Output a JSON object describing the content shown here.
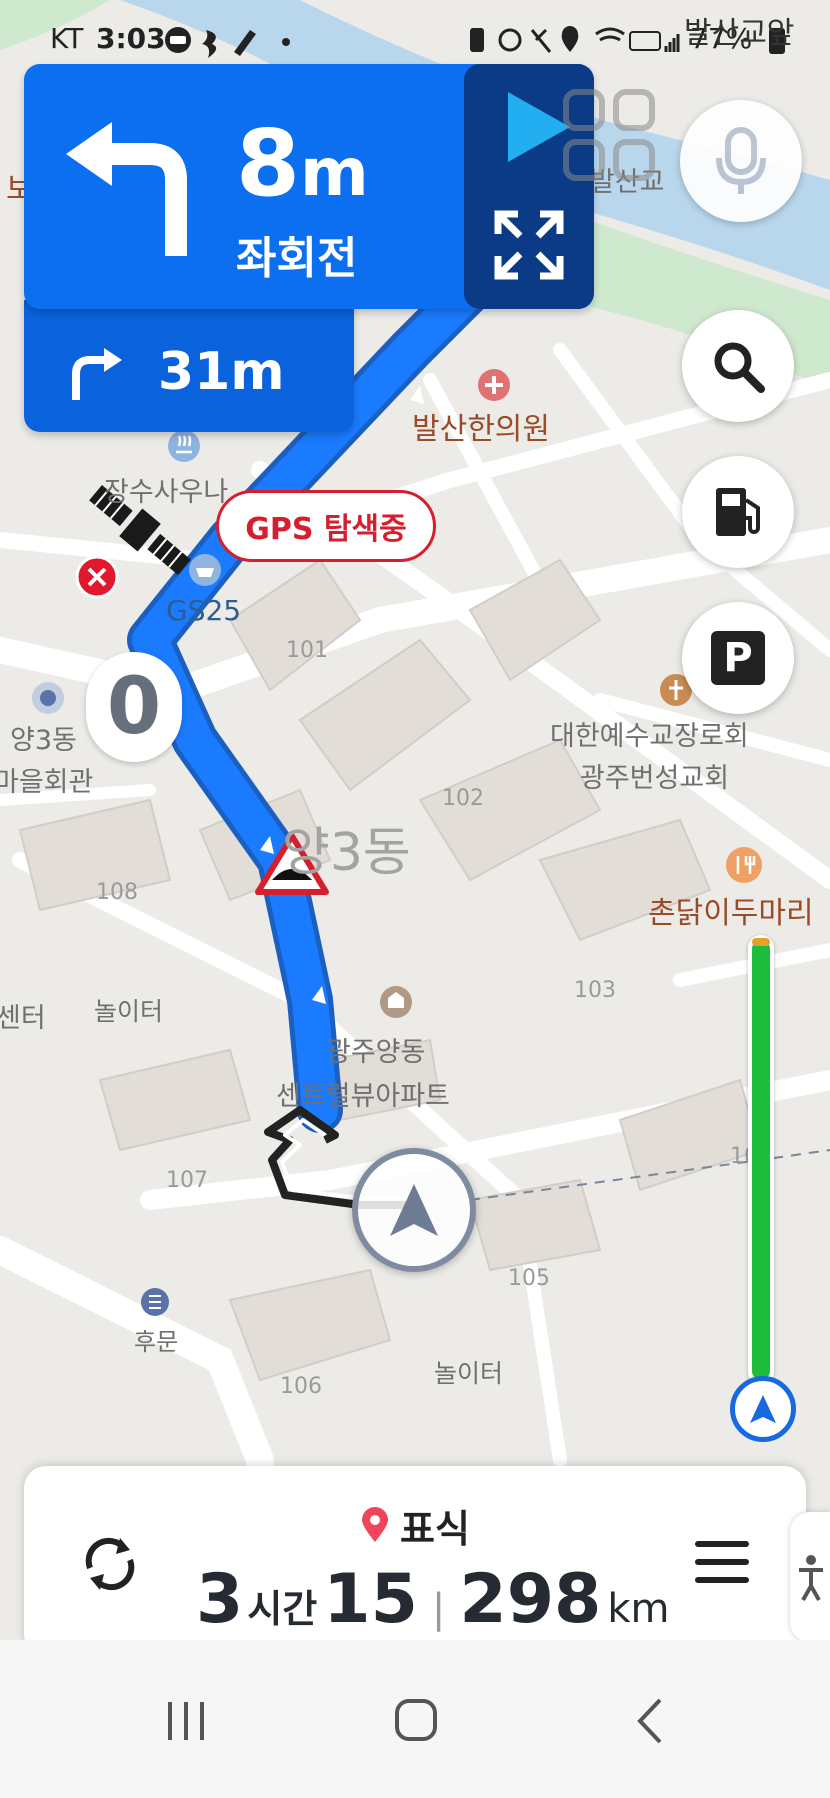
{
  "status_bar": {
    "carrier": "KT",
    "time": "3:03",
    "battery": "77%"
  },
  "turn_card": {
    "distance_value": "8",
    "distance_unit": "m",
    "instruction": "좌회전",
    "next_distance": "31m",
    "turn_icon": "turn-left-arrow-icon",
    "next_turn_icon": "turn-right-arrow-icon"
  },
  "gps_status": {
    "label": "GPS 탐색중"
  },
  "speed": {
    "value": "0"
  },
  "map": {
    "district": "양3동",
    "places": {
      "clinic": "발산한의원",
      "sauna": "장수사우나",
      "gs25": "GS25",
      "community_line1": "양3동",
      "community_line2": "마을회관",
      "church_line1": "대한예수교장로회",
      "church_line2": "광주번성교회",
      "restaurant": "촌닭이두마리",
      "apartment_line1": "광주양동",
      "apartment_line2": "센트럴뷰아파트",
      "playground_1": "놀이터",
      "playground_2": "놀이터",
      "back_gate": "후문",
      "bridge": "발산교앞",
      "bridge_partial": "발산교",
      "center_partial": "센터",
      "top_left_partial": "보"
    },
    "buildings": [
      "101",
      "102",
      "103",
      "105",
      "106",
      "107",
      "108",
      "10"
    ]
  },
  "side_buttons": {
    "voice": "mic-icon",
    "search": "search-icon",
    "gas": "gas-station-icon",
    "parking": "P"
  },
  "bottom_card": {
    "destination": "표식",
    "eta_hours": "3",
    "eta_hours_unit": "시간",
    "eta_minutes": "15",
    "distance": "298",
    "distance_unit": "km"
  },
  "colors": {
    "route_blue": "#0b6ff0",
    "alert_red": "#d51e2e",
    "progress_green": "#1ebd3c"
  }
}
